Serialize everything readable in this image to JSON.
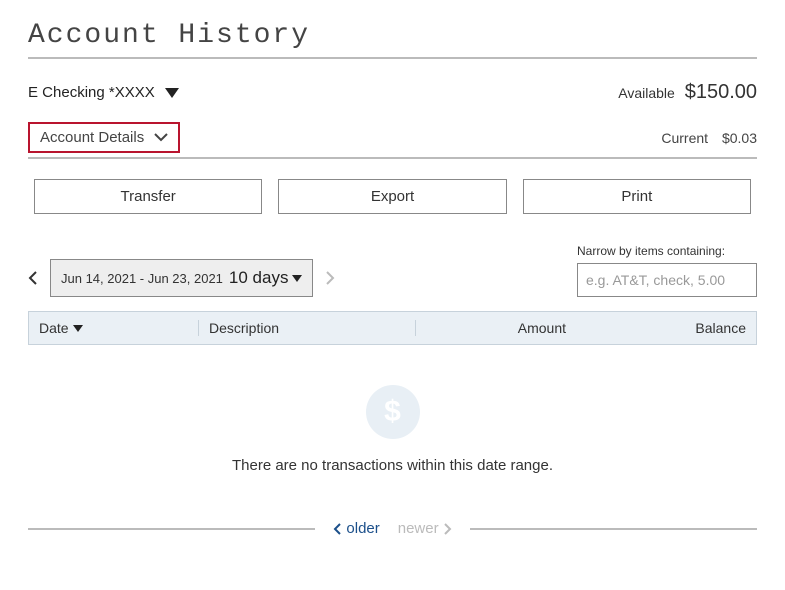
{
  "title": "Account History",
  "account": {
    "name": "E Checking *XXXX",
    "available_label": "Available",
    "available_amount": "$150.00",
    "details_label": "Account Details",
    "current_label": "Current",
    "current_amount": "$0.03"
  },
  "actions": {
    "transfer": "Transfer",
    "export": "Export",
    "print": "Print"
  },
  "filter": {
    "date_range": "Jun 14, 2021 - Jun 23, 2021",
    "days": "10 days",
    "narrow_label": "Narrow by items containing:",
    "narrow_placeholder": "e.g. AT&T, check, 5.00"
  },
  "table": {
    "columns": {
      "date": "Date",
      "description": "Description",
      "amount": "Amount",
      "balance": "Balance"
    },
    "rows": []
  },
  "empty": {
    "message": "There are no transactions within this date range."
  },
  "pagination": {
    "older": "older",
    "newer": "newer"
  }
}
